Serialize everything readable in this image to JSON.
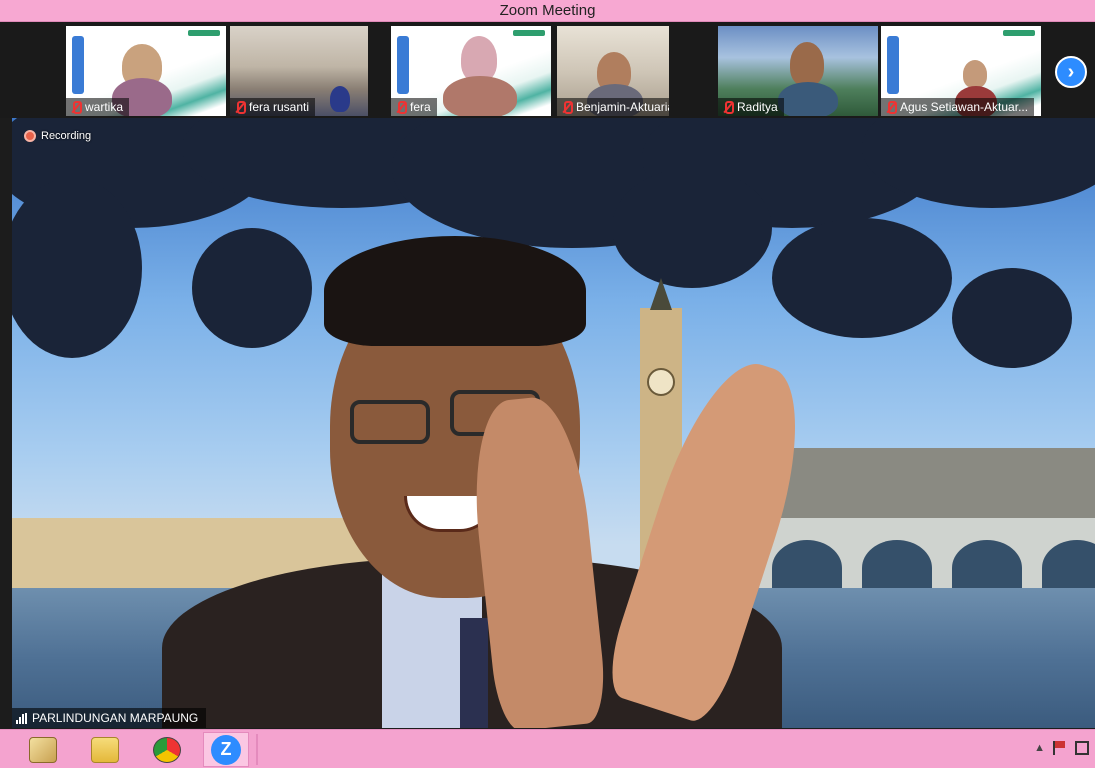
{
  "window": {
    "title": "Zoom Meeting"
  },
  "participants": [
    {
      "name": "wartika",
      "muted": true
    },
    {
      "name": "fera rusanti",
      "muted": true
    },
    {
      "name": "fera",
      "muted": true
    },
    {
      "name": "Benjamin-Aktuaria",
      "muted": true
    },
    {
      "name": "Raditya",
      "muted": true
    },
    {
      "name": "Agus Setiawan-Aktuar...",
      "muted": true
    }
  ],
  "gallery": {
    "next_icon": "chevron-right-icon",
    "next_glyph": "›"
  },
  "main_video": {
    "recording_label": "Recording",
    "speaker_name": "PARLINDUNGAN MARPAUNG",
    "signal_icon": "signal-bars-icon"
  },
  "taskbar": {
    "items": [
      {
        "icon": "control-panel-icon"
      },
      {
        "icon": "file-explorer-icon"
      },
      {
        "icon": "chrome-icon"
      },
      {
        "icon": "zoom-icon",
        "glyph": "Z",
        "active": true
      }
    ],
    "tray_icons": [
      "show-hidden-icons-icon",
      "action-center-flag-icon",
      "display-icon"
    ]
  },
  "colors": {
    "title_bar": "#f7a8d2",
    "taskbar": "#f4a3cf",
    "zoom_blue": "#2d8cff",
    "muted_red": "#ee3333",
    "recording_dot": "#e8624a"
  }
}
